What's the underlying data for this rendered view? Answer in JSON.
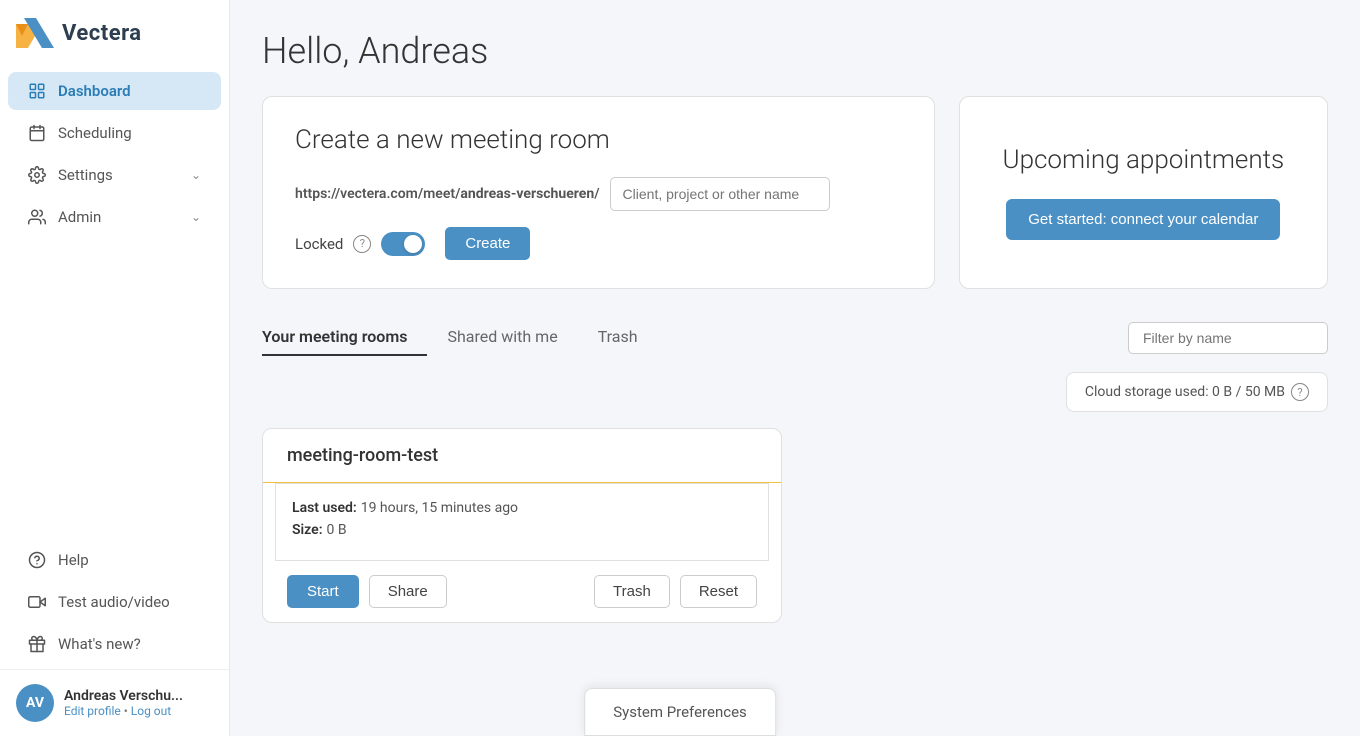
{
  "logo": {
    "text": "Vectera"
  },
  "sidebar": {
    "items": [
      {
        "id": "dashboard",
        "label": "Dashboard",
        "active": true
      },
      {
        "id": "scheduling",
        "label": "Scheduling",
        "active": false
      },
      {
        "id": "settings",
        "label": "Settings",
        "active": false,
        "hasChevron": true
      },
      {
        "id": "admin",
        "label": "Admin",
        "active": false,
        "hasChevron": true
      }
    ],
    "secondary": [
      {
        "id": "help",
        "label": "Help"
      },
      {
        "id": "test-audio-video",
        "label": "Test audio/video"
      },
      {
        "id": "whats-new",
        "label": "What's new?"
      }
    ]
  },
  "user": {
    "initials": "AV",
    "name": "Andreas Verschu...",
    "edit_label": "Edit profile",
    "logout_label": "Log out"
  },
  "page": {
    "greeting": "Hello, Andreas"
  },
  "create_room": {
    "title": "Create a new meeting room",
    "url_base": "https://vectera.com/meet/",
    "url_slug": "andreas-verschueren",
    "url_slash": "/",
    "input_placeholder": "Client, project or other name",
    "locked_label": "Locked",
    "create_button": "Create",
    "locked_on": true
  },
  "upcoming": {
    "title": "Upcoming appointments",
    "connect_button": "Get started: connect your calendar"
  },
  "tabs": [
    {
      "id": "your-rooms",
      "label": "Your meeting rooms",
      "active": true
    },
    {
      "id": "shared",
      "label": "Shared with me",
      "active": false
    },
    {
      "id": "trash",
      "label": "Trash",
      "active": false
    }
  ],
  "filter": {
    "placeholder": "Filter by name"
  },
  "cloud_storage": {
    "label": "Cloud storage used: 0 B / 50 MB"
  },
  "meeting_room": {
    "name": "meeting-room-test",
    "last_used": "19 hours, 15 minutes ago",
    "last_used_label": "Last used:",
    "size_label": "Size:",
    "size": "0 B",
    "start_button": "Start",
    "share_button": "Share",
    "trash_button": "Trash",
    "reset_button": "Reset"
  },
  "system_preferences": {
    "label": "System Preferences"
  }
}
